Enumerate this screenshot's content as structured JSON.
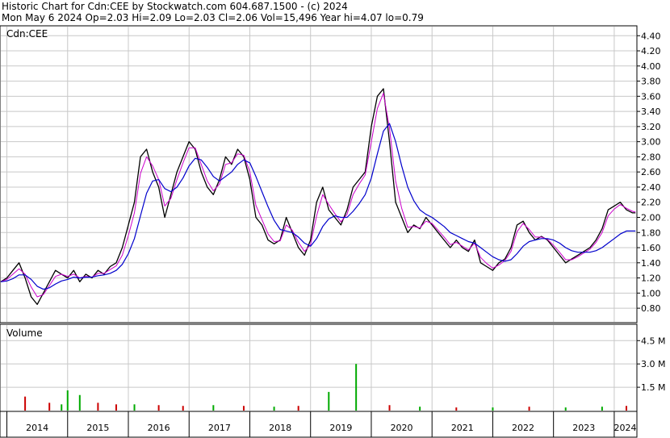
{
  "header": {
    "line1": "Historic Chart for Cdn:CEE by Stockwatch.com 604.687.1500 - (c) 2024",
    "line2": "Mon May  6 2024  Op=2.03  Hi=2.09  Lo=2.03  Cl=2.06  Vol=15,496  Year hi=4.07  lo=0.79"
  },
  "chart_data": {
    "type": "line",
    "price_panel": {
      "label": "Cdn:CEE",
      "ylim": [
        0.62,
        4.52
      ],
      "yticks": [
        "4.40",
        "4.20",
        "4.00",
        "3.80",
        "3.60",
        "3.40",
        "3.20",
        "3.00",
        "2.80",
        "2.60",
        "2.40",
        "2.20",
        "2.00",
        "1.80",
        "1.60",
        "1.40",
        "1.20",
        "1.00",
        "0.80"
      ],
      "grid": true,
      "colors": {
        "price": "#000000",
        "short_ma": "#cc00cc",
        "long_ma": "#0000cc"
      },
      "x": [
        2013.9,
        2014.0,
        2014.1,
        2014.2,
        2014.3,
        2014.4,
        2014.5,
        2014.6,
        2014.7,
        2014.8,
        2014.9,
        2015.0,
        2015.1,
        2015.2,
        2015.3,
        2015.4,
        2015.5,
        2015.6,
        2015.7,
        2015.8,
        2015.9,
        2016.0,
        2016.1,
        2016.2,
        2016.3,
        2016.4,
        2016.5,
        2016.6,
        2016.7,
        2016.8,
        2016.9,
        2017.0,
        2017.1,
        2017.2,
        2017.3,
        2017.4,
        2017.5,
        2017.6,
        2017.7,
        2017.8,
        2017.9,
        2018.0,
        2018.1,
        2018.2,
        2018.3,
        2018.4,
        2018.5,
        2018.6,
        2018.7,
        2018.8,
        2018.9,
        2019.0,
        2019.1,
        2019.2,
        2019.3,
        2019.4,
        2019.5,
        2019.6,
        2019.7,
        2019.8,
        2019.9,
        2020.0,
        2020.1,
        2020.2,
        2020.3,
        2020.4,
        2020.5,
        2020.6,
        2020.7,
        2020.8,
        2020.9,
        2021.0,
        2021.1,
        2021.2,
        2021.3,
        2021.4,
        2021.5,
        2021.6,
        2021.7,
        2021.8,
        2021.9,
        2022.0,
        2022.1,
        2022.2,
        2022.3,
        2022.4,
        2022.5,
        2022.6,
        2022.7,
        2022.8,
        2022.9,
        2023.0,
        2023.1,
        2023.2,
        2023.3,
        2023.4,
        2023.5,
        2023.6,
        2023.7,
        2023.8,
        2023.9,
        2024.0,
        2024.1,
        2024.2,
        2024.3,
        2024.35
      ],
      "close": [
        1.15,
        1.2,
        1.3,
        1.4,
        1.2,
        0.95,
        0.85,
        1.0,
        1.15,
        1.3,
        1.25,
        1.2,
        1.3,
        1.15,
        1.25,
        1.2,
        1.3,
        1.25,
        1.35,
        1.4,
        1.6,
        1.9,
        2.2,
        2.8,
        2.9,
        2.6,
        2.4,
        2.0,
        2.3,
        2.6,
        2.8,
        3.0,
        2.9,
        2.6,
        2.4,
        2.3,
        2.5,
        2.8,
        2.7,
        2.9,
        2.8,
        2.5,
        2.0,
        1.9,
        1.7,
        1.65,
        1.7,
        2.0,
        1.8,
        1.6,
        1.5,
        1.7,
        2.2,
        2.4,
        2.1,
        2.0,
        1.9,
        2.1,
        2.4,
        2.5,
        2.6,
        3.2,
        3.6,
        3.7,
        3.0,
        2.2,
        2.0,
        1.8,
        1.9,
        1.85,
        2.0,
        1.9,
        1.8,
        1.7,
        1.6,
        1.7,
        1.6,
        1.55,
        1.7,
        1.4,
        1.35,
        1.3,
        1.4,
        1.45,
        1.6,
        1.9,
        1.95,
        1.8,
        1.7,
        1.75,
        1.7,
        1.6,
        1.5,
        1.4,
        1.45,
        1.5,
        1.55,
        1.6,
        1.7,
        1.85,
        2.1,
        2.15,
        2.2,
        2.1,
        2.06,
        2.06
      ],
      "short_ma": [
        1.15,
        1.18,
        1.25,
        1.32,
        1.25,
        1.08,
        0.95,
        0.98,
        1.1,
        1.22,
        1.25,
        1.22,
        1.25,
        1.2,
        1.22,
        1.21,
        1.26,
        1.26,
        1.31,
        1.36,
        1.5,
        1.76,
        2.06,
        2.58,
        2.8,
        2.68,
        2.5,
        2.15,
        2.25,
        2.5,
        2.72,
        2.92,
        2.92,
        2.7,
        2.48,
        2.35,
        2.44,
        2.7,
        2.72,
        2.84,
        2.82,
        2.6,
        2.16,
        1.97,
        1.78,
        1.68,
        1.69,
        1.9,
        1.83,
        1.67,
        1.55,
        1.64,
        2.02,
        2.3,
        2.17,
        2.05,
        1.94,
        2.04,
        2.3,
        2.44,
        2.56,
        3.0,
        3.44,
        3.64,
        3.18,
        2.48,
        2.12,
        1.87,
        1.88,
        1.86,
        1.95,
        1.92,
        1.83,
        1.74,
        1.64,
        1.67,
        1.62,
        1.57,
        1.66,
        1.47,
        1.39,
        1.33,
        1.37,
        1.43,
        1.55,
        1.81,
        1.92,
        1.84,
        1.74,
        1.74,
        1.71,
        1.63,
        1.54,
        1.44,
        1.44,
        1.48,
        1.53,
        1.58,
        1.67,
        1.8,
        2.02,
        2.11,
        2.17,
        2.12,
        2.08,
        2.07
      ],
      "long_ma": [
        1.15,
        1.16,
        1.19,
        1.24,
        1.24,
        1.18,
        1.09,
        1.05,
        1.07,
        1.12,
        1.16,
        1.18,
        1.21,
        1.2,
        1.21,
        1.21,
        1.23,
        1.24,
        1.26,
        1.3,
        1.38,
        1.52,
        1.72,
        2.02,
        2.32,
        2.48,
        2.5,
        2.38,
        2.34,
        2.4,
        2.52,
        2.68,
        2.78,
        2.76,
        2.66,
        2.54,
        2.48,
        2.54,
        2.6,
        2.7,
        2.76,
        2.72,
        2.54,
        2.34,
        2.14,
        1.96,
        1.84,
        1.82,
        1.8,
        1.74,
        1.66,
        1.62,
        1.72,
        1.88,
        1.98,
        2.02,
        2.0,
        2.0,
        2.08,
        2.18,
        2.3,
        2.52,
        2.84,
        3.14,
        3.24,
        3.0,
        2.68,
        2.4,
        2.22,
        2.1,
        2.04,
        2.0,
        1.94,
        1.88,
        1.8,
        1.76,
        1.72,
        1.68,
        1.66,
        1.6,
        1.54,
        1.48,
        1.44,
        1.42,
        1.44,
        1.52,
        1.62,
        1.68,
        1.7,
        1.72,
        1.72,
        1.7,
        1.66,
        1.6,
        1.56,
        1.54,
        1.54,
        1.54,
        1.56,
        1.6,
        1.66,
        1.72,
        1.78,
        1.82,
        1.82,
        1.82
      ]
    },
    "volume_panel": {
      "label": "Volume",
      "ylim": [
        0,
        5.5
      ],
      "unit": "M",
      "yticks": [
        {
          "label": "4.5 M",
          "value": 4.5
        },
        {
          "label": "3.0 M",
          "value": 3.0
        },
        {
          "label": "1.5 M",
          "value": 1.5
        }
      ],
      "bars": [
        {
          "x": 2014.3,
          "value": 0.9,
          "color": "#cc0000"
        },
        {
          "x": 2014.7,
          "value": 0.5,
          "color": "#cc0000"
        },
        {
          "x": 2014.9,
          "value": 0.4,
          "color": "#00aa00"
        },
        {
          "x": 2015.0,
          "value": 1.3,
          "color": "#00aa00"
        },
        {
          "x": 2015.2,
          "value": 1.0,
          "color": "#00aa00"
        },
        {
          "x": 2015.5,
          "value": 0.5,
          "color": "#cc0000"
        },
        {
          "x": 2015.8,
          "value": 0.4,
          "color": "#cc0000"
        },
        {
          "x": 2016.1,
          "value": 0.4,
          "color": "#00aa00"
        },
        {
          "x": 2016.5,
          "value": 0.35,
          "color": "#cc0000"
        },
        {
          "x": 2016.9,
          "value": 0.3,
          "color": "#cc0000"
        },
        {
          "x": 2017.4,
          "value": 0.35,
          "color": "#00aa00"
        },
        {
          "x": 2017.9,
          "value": 0.3,
          "color": "#cc0000"
        },
        {
          "x": 2018.4,
          "value": 0.25,
          "color": "#00aa00"
        },
        {
          "x": 2018.8,
          "value": 0.3,
          "color": "#cc0000"
        },
        {
          "x": 2019.3,
          "value": 1.2,
          "color": "#00aa00"
        },
        {
          "x": 2019.75,
          "value": 3.0,
          "color": "#00aa00"
        },
        {
          "x": 2020.3,
          "value": 0.35,
          "color": "#cc0000"
        },
        {
          "x": 2020.8,
          "value": 0.25,
          "color": "#00aa00"
        },
        {
          "x": 2021.4,
          "value": 0.2,
          "color": "#cc0000"
        },
        {
          "x": 2022.0,
          "value": 0.2,
          "color": "#00aa00"
        },
        {
          "x": 2022.6,
          "value": 0.25,
          "color": "#cc0000"
        },
        {
          "x": 2023.2,
          "value": 0.2,
          "color": "#00aa00"
        },
        {
          "x": 2023.8,
          "value": 0.25,
          "color": "#00aa00"
        },
        {
          "x": 2024.2,
          "value": 0.3,
          "color": "#cc0000"
        }
      ]
    },
    "x_axis": {
      "labels": [
        {
          "label": "2014",
          "x": 2014.0
        },
        {
          "label": "2015",
          "x": 2015.0
        },
        {
          "label": "2016",
          "x": 2016.0
        },
        {
          "label": "2017",
          "x": 2017.0
        },
        {
          "label": "2018",
          "x": 2018.0
        },
        {
          "label": "2019",
          "x": 2019.0
        },
        {
          "label": "2020",
          "x": 2020.0
        },
        {
          "label": "2021",
          "x": 2021.0
        },
        {
          "label": "2022",
          "x": 2022.0
        },
        {
          "label": "2023",
          "x": 2023.0
        },
        {
          "label": "2024",
          "x": 2024.0
        }
      ],
      "xlim": [
        2013.9,
        2024.36
      ]
    }
  }
}
